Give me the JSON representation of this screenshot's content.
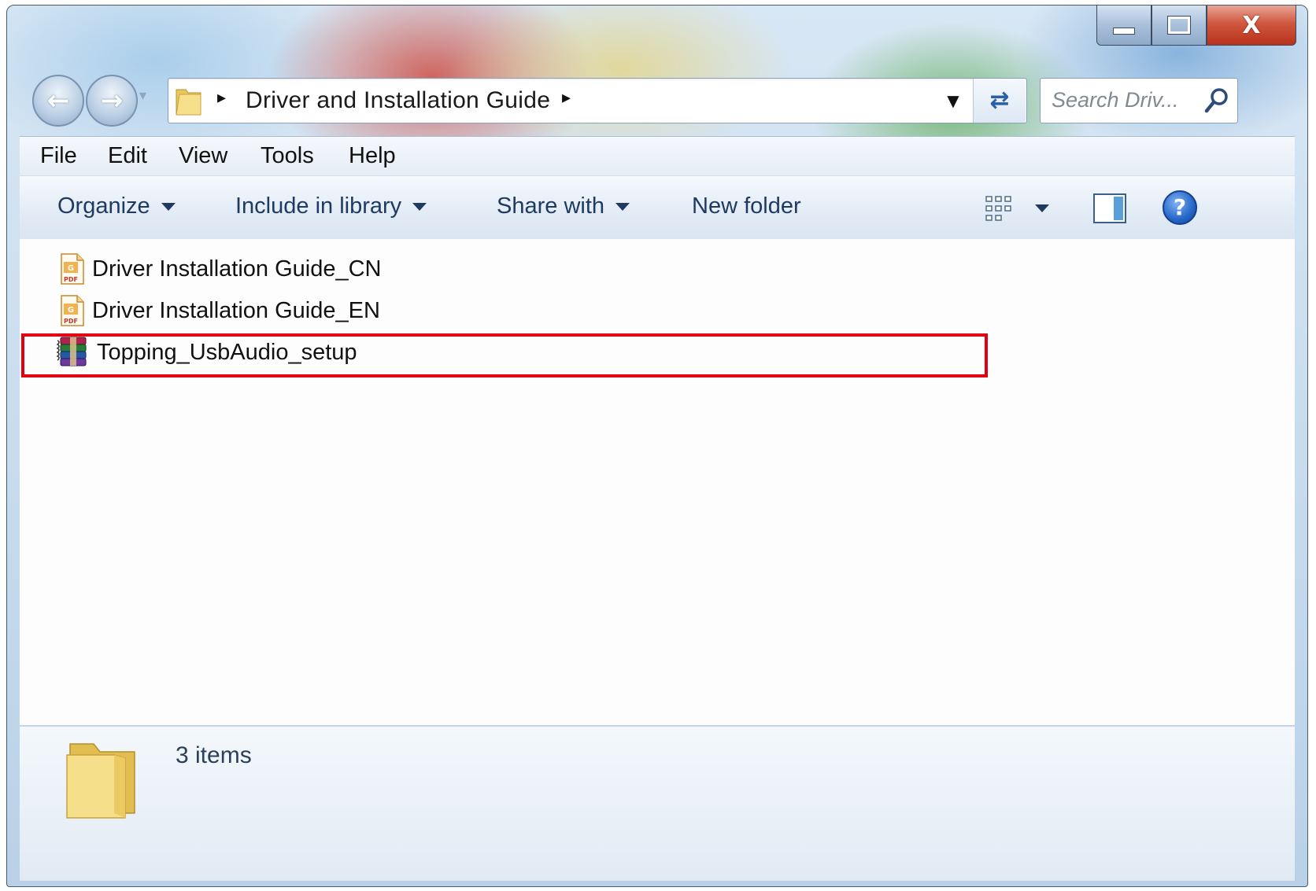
{
  "window": {
    "caption_buttons": [
      {
        "name": "minimize",
        "icon": "minimize-icon"
      },
      {
        "name": "maximize",
        "icon": "maximize-icon"
      },
      {
        "name": "close",
        "icon": "close-icon",
        "glyph": "X"
      }
    ]
  },
  "navigation": {
    "breadcrumb": "Driver and  Installation Guide",
    "search_placeholder": "Search Driv..."
  },
  "menu": {
    "file": "File",
    "edit": "Edit",
    "view": "View",
    "tools": "Tools",
    "help": "Help"
  },
  "toolbar": {
    "organize": "Organize",
    "include_in_library": "Include in library",
    "share_with": "Share with",
    "new_folder": "New folder",
    "help_glyph": "?"
  },
  "files": [
    {
      "name": "Driver Installation Guide_CN",
      "icon": "pdf-icon"
    },
    {
      "name": "Driver Installation Guide_EN",
      "icon": "pdf-icon"
    },
    {
      "name": "Topping_UsbAudio_setup",
      "icon": "winrar-archive-icon",
      "highlighted": true
    }
  ],
  "status": {
    "item_count": "3 items"
  },
  "colors": {
    "highlight_border": "#e00012",
    "toolbar_text": "#1e3a5f"
  }
}
